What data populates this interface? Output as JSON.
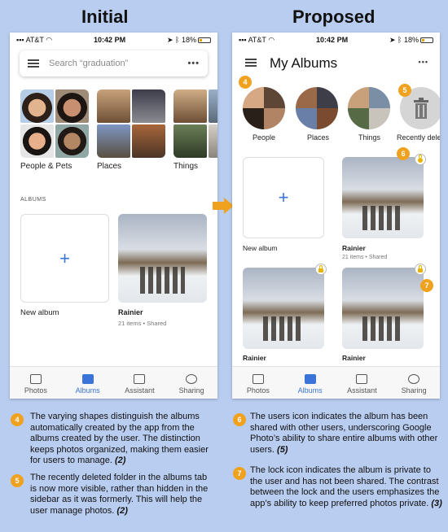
{
  "headings": {
    "initial": "Initial",
    "proposed": "Proposed"
  },
  "statusbar": {
    "carrier": "AT&T",
    "time": "10:42 PM",
    "battery": "18%"
  },
  "initial": {
    "search_placeholder": "Search “graduation”",
    "tiles": [
      "People & Pets",
      "Places",
      "Things"
    ],
    "albums_section": "ALBUMS",
    "new_album": "New album",
    "album": {
      "name": "Rainier",
      "items": "21 items",
      "shared": "Shared"
    }
  },
  "proposed": {
    "title": "My Albums",
    "circles": [
      "People",
      "Places",
      "Things",
      "Recently dele"
    ],
    "new_album": "New album",
    "album1": {
      "name": "Rainier",
      "items": "21 items",
      "shared": "Shared"
    },
    "album2_name": "Rainier",
    "album3_name": "Rainier"
  },
  "nav": [
    "Photos",
    "Albums",
    "Assistant",
    "Sharing"
  ],
  "badges": [
    "4",
    "5",
    "6",
    "7"
  ],
  "notes": {
    "n4": {
      "text": "The varying shapes distinguish the albums automatically created by the app from the albums created by the user. The distinction keeps photos organized, making them easier for users to manage.",
      "ref": "(2)"
    },
    "n5": {
      "text": "The recently deleted folder in the albums tab is now more visible, rather than hidden in the sidebar as it was formerly. This will help the user manage photos.",
      "ref": "(2)"
    },
    "n6": {
      "text": "The users icon indicates the album has been shared with other users, underscoring Google Photo’s ability to share entire albums with other users.",
      "ref": "(5)"
    },
    "n7": {
      "text": "The lock icon indicates the album is private to the user and has not been shared. The contrast between the lock and the users emphasizes the app’s ability to keep preferred photos private.",
      "ref": "(3)"
    }
  },
  "colors": {
    "accent": "#3b74d8",
    "badge": "#f0a21f",
    "background": "#b9cdf0"
  }
}
